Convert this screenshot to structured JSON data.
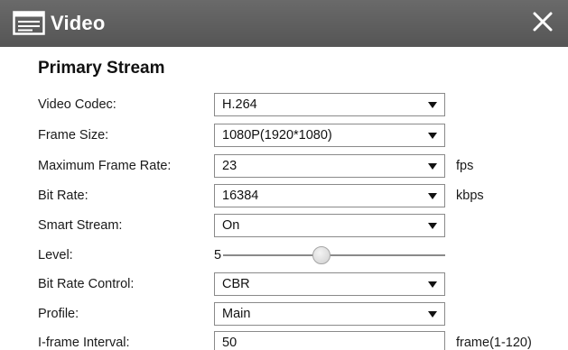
{
  "window": {
    "title": "Video",
    "icon": "video-settings-icon",
    "close_icon": "close-icon"
  },
  "section": {
    "title": "Primary Stream"
  },
  "fields": {
    "video_codec": {
      "label": "Video Codec:",
      "value": "H.264"
    },
    "frame_size": {
      "label": "Frame Size:",
      "value": "1080P(1920*1080)"
    },
    "max_frame_rate": {
      "label": "Maximum Frame Rate:",
      "value": "23",
      "unit": "fps"
    },
    "bit_rate": {
      "label": "Bit Rate:",
      "value": "16384",
      "unit": "kbps"
    },
    "smart_stream": {
      "label": "Smart Stream:",
      "value": "On"
    },
    "level": {
      "label": "Level:",
      "value": "5",
      "min": 1,
      "max": 10
    },
    "bit_rate_control": {
      "label": "Bit Rate Control:",
      "value": "CBR"
    },
    "profile": {
      "label": "Profile:",
      "value": "Main"
    },
    "iframe_interval": {
      "label": "I-frame Interval:",
      "value": "50",
      "unit": "frame(1-120)"
    }
  },
  "colors": {
    "titlebar": "#5e5e5e",
    "border": "#8a8a8a"
  }
}
